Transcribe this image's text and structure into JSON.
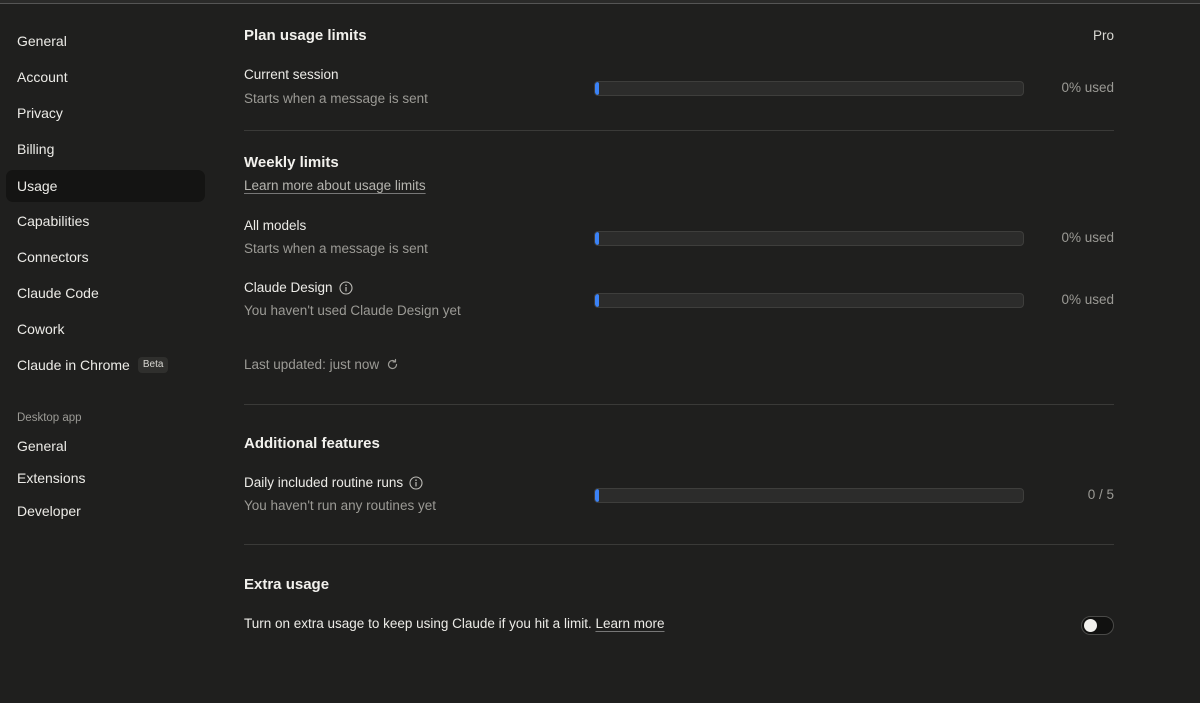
{
  "sidebar": {
    "items": [
      {
        "label": "General"
      },
      {
        "label": "Account"
      },
      {
        "label": "Privacy"
      },
      {
        "label": "Billing"
      },
      {
        "label": "Usage",
        "active": true
      },
      {
        "label": "Capabilities"
      },
      {
        "label": "Connectors"
      },
      {
        "label": "Claude Code"
      },
      {
        "label": "Cowork"
      },
      {
        "label": "Claude in Chrome",
        "badge": "Beta"
      }
    ],
    "desktop_section_label": "Desktop app",
    "desktop_items": [
      {
        "label": "General"
      },
      {
        "label": "Extensions"
      },
      {
        "label": "Developer"
      }
    ]
  },
  "plan": {
    "title": "Plan usage limits",
    "plan_name": "Pro",
    "current_session": {
      "label": "Current session",
      "sub": "Starts when a message is sent",
      "used_text": "0% used",
      "fraction": 0.0
    }
  },
  "weekly": {
    "title": "Weekly limits",
    "learn_more": "Learn more about usage limits",
    "all_models": {
      "label": "All models",
      "sub": "Starts when a message is sent",
      "used_text": "0% used",
      "fraction": 0.0
    },
    "claude_design": {
      "label": "Claude Design",
      "sub": "You haven't used Claude Design yet",
      "used_text": "0% used",
      "fraction": 0.0
    },
    "last_updated": "Last updated: just now"
  },
  "additional": {
    "title": "Additional features",
    "routine_runs": {
      "label": "Daily included routine runs",
      "sub": "You haven't run any routines yet",
      "count_text": "0 / 5",
      "fraction": 0.0
    }
  },
  "extra": {
    "title": "Extra usage",
    "description": "Turn on extra usage to keep using Claude if you hit a limit.",
    "learn_more": "Learn more",
    "toggle_on": false
  },
  "colors": {
    "accent": "#3b82f6",
    "background": "#1f1f1e",
    "active_nav": "#141413"
  }
}
